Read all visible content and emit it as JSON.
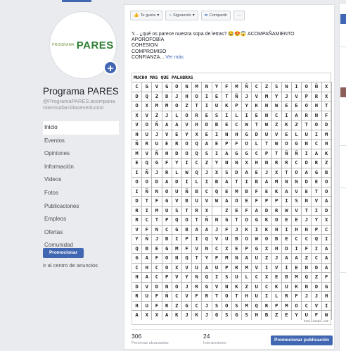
{
  "sidebar": {
    "logo_prefix": "PROGRAMA",
    "logo_main": "PARES",
    "page_name": "Programa PARES",
    "page_handle": "@ProgramaPARES.acompanamientoafamiliaseneducion",
    "nav": [
      {
        "label": "Inicio",
        "active": true
      },
      {
        "label": "Eventos"
      },
      {
        "label": "Opiniones"
      },
      {
        "label": "Información"
      },
      {
        "label": "Videos"
      },
      {
        "label": "Fotos"
      },
      {
        "label": "Publicaciones"
      },
      {
        "label": "Empleos"
      },
      {
        "label": "Ofertas"
      },
      {
        "label": "Comunidad"
      }
    ],
    "promote_label": "Promocionar",
    "ads_center_label": "Ir al centro de anuncios"
  },
  "post": {
    "actions": {
      "like": "Te gusta",
      "follow": "Siguiendo",
      "share": "Compartir",
      "more": "···"
    },
    "text": {
      "line1": "Y... ¿qué os parece nuestra sopa de letras? 😂😍😱 ACOMPAÑAMIENTO",
      "line2": "APOROFOBIA",
      "line3": "COHESION",
      "line4": "COMPROMISO",
      "line5": "CONFIANZA...",
      "see_more": "Ver más"
    },
    "puzzle_title": "MUCHO MAS QUE PALABRAS",
    "watermark": "tenisiando.com",
    "grid": [
      "CGVGONMNYFMÑCZSNIOÑX",
      "DQZDJHOIETÑJVMYJVPRX",
      "OXMMOZTIUKPYKNWEEOHT",
      "XVZJLORESILIENCIARNF",
      "VOÑAAVHDBECWTWZKZTOD",
      "HUJVEYXEINHGDUVELUIM",
      "ÑRUEROQAEPFOLTWOGNCH",
      "MVÑHDOQSIAGGCPTÑÑIAK",
      "EQGFYICZYNNXHNRRCDRZ",
      "IÑJRLWQJXSDAEJXTOAGB",
      "OODADILIBATIBAMNNDEO",
      "IÑNOUÑBCQEMBFEKAVETO",
      "DTFGVBUVWAOEFPPISNVA",
      "RIMUSTRX ZEFADRWVTID",
      "RCTPQOTÑNGTOGKOEEJYX",
      "VFNCGBAAJFJKIKHIHNPC",
      "YÑJBIPIQVUBOWOBECCQI",
      "QBEGMFVNCXEPGXHDIFIA",
      "GAFONQTYPMNAUZJAAZCA",
      "CHCOXVUAUPRMVIVIENDA",
      "HACPVYNQISULCXEBMQZF",
      "DVDNOJRGVNKZUCKUKNDG",
      "RUFÑCVFRTOTHUILRFJJH",
      "HUFRZGCJSOSMQRPMOCVI",
      "AXXAKJKJGSGSHBZEYUFW"
    ],
    "stats": [
      {
        "value": "306",
        "label": "Personas alcanzadas"
      },
      {
        "value": "24",
        "label": "Interacciones"
      }
    ],
    "promote_post_label": "Promocionar publicación"
  }
}
